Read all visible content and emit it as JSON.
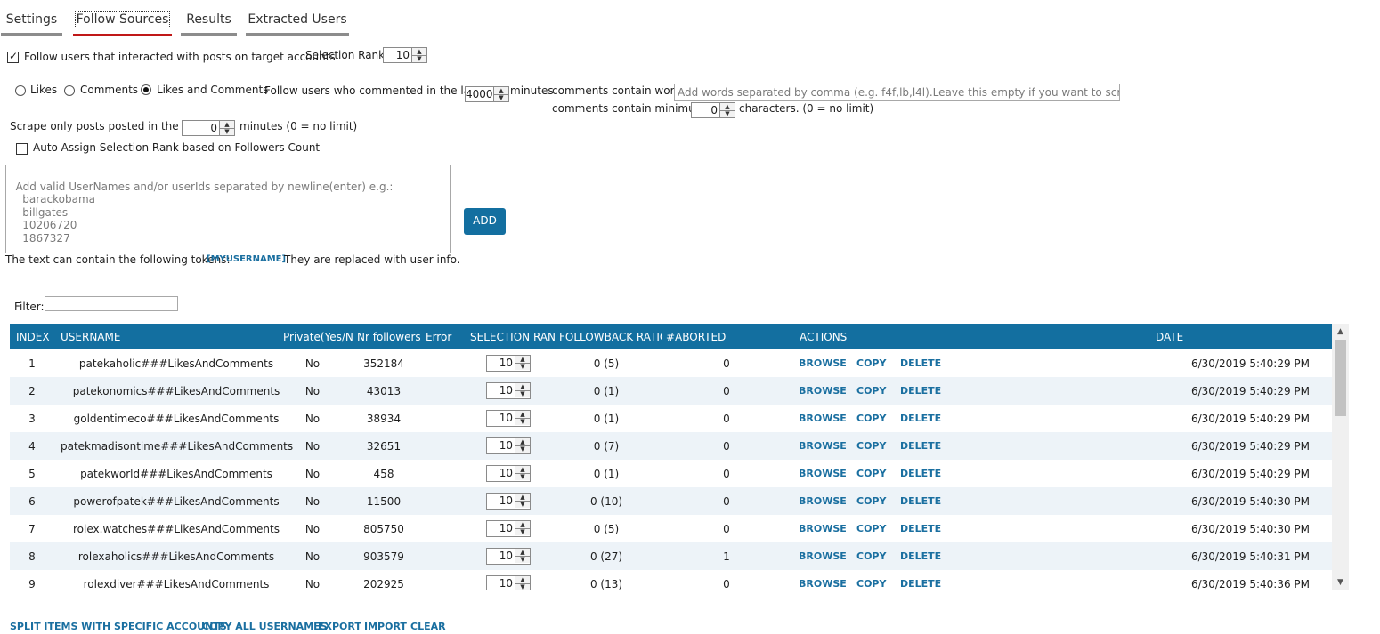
{
  "tabs": [
    {
      "label": "Settings"
    },
    {
      "label": "Follow Sources"
    },
    {
      "label": "Results"
    },
    {
      "label": "Extracted Users"
    }
  ],
  "interact": {
    "checked": true,
    "label": "Follow users that interacted with posts on target accounts",
    "rank_label": "Selection Rank",
    "rank_value": "10"
  },
  "mode": {
    "likes": "Likes",
    "comments": "Comments",
    "likes_and_comments": "Likes and Comments",
    "selected": "likes_and_comments",
    "commented_label": "Follow users who commented in the last",
    "commented_value": "4000",
    "minutes_label": "minutes",
    "words_label": "comments contain words",
    "words_placeholder": "Add words separated by comma (e.g. f4f,lb,l4l).Leave this empty if you want to scrape all comments",
    "min_label": "comments contain minimum",
    "min_value": "0",
    "chars_label": "characters. (0 = no limit)"
  },
  "scrape": {
    "label": "Scrape only posts posted in the last",
    "value": "0",
    "suffix": "minutes (0 = no limit)"
  },
  "auto_assign": {
    "checked": false,
    "label": "Auto Assign Selection Rank based on Followers Count"
  },
  "usernames": {
    "placeholder": "Add valid UserNames and/or userIds separated by newline(enter) e.g.:\n    barackobama\n    billgates\n    10206720\n    1867327",
    "add_label": "ADD"
  },
  "tokens": {
    "prefix": "The text can contain the following tokens:",
    "token": "[MYUSERNAME]",
    "suffix": "They are replaced with user info."
  },
  "filter": {
    "label": "Filter:",
    "value": ""
  },
  "grid": {
    "columns": [
      "INDEX",
      "USERNAME",
      "Private(Yes/No)",
      "Nr followers",
      "Error",
      "SELECTION RANK",
      "FOLLOWBACK RATIO",
      "#ABORTED",
      "ACTIONS",
      "DATE"
    ],
    "actions": [
      "BROWSE",
      "COPY",
      "DELETE"
    ],
    "rows": [
      {
        "index": "1",
        "username": "patekaholic###LikesAndComments",
        "private": "No",
        "followers": "352184",
        "error": "",
        "rank": "10",
        "ratio": "0 (5)",
        "aborted": "0",
        "date": "6/30/2019 5:40:29 PM"
      },
      {
        "index": "2",
        "username": "patekonomics###LikesAndComments",
        "private": "No",
        "followers": "43013",
        "error": "",
        "rank": "10",
        "ratio": "0 (1)",
        "aborted": "0",
        "date": "6/30/2019 5:40:29 PM"
      },
      {
        "index": "3",
        "username": "goldentimeco###LikesAndComments",
        "private": "No",
        "followers": "38934",
        "error": "",
        "rank": "10",
        "ratio": "0 (1)",
        "aborted": "0",
        "date": "6/30/2019 5:40:29 PM"
      },
      {
        "index": "4",
        "username": "patekmadisontime###LikesAndComments",
        "private": "No",
        "followers": "32651",
        "error": "",
        "rank": "10",
        "ratio": "0 (7)",
        "aborted": "0",
        "date": "6/30/2019 5:40:29 PM"
      },
      {
        "index": "5",
        "username": "patekworld###LikesAndComments",
        "private": "No",
        "followers": "458",
        "error": "",
        "rank": "10",
        "ratio": "0 (1)",
        "aborted": "0",
        "date": "6/30/2019 5:40:29 PM"
      },
      {
        "index": "6",
        "username": "powerofpatek###LikesAndComments",
        "private": "No",
        "followers": "11500",
        "error": "",
        "rank": "10",
        "ratio": "0 (10)",
        "aborted": "0",
        "date": "6/30/2019 5:40:30 PM"
      },
      {
        "index": "7",
        "username": "rolex.watches###LikesAndComments",
        "private": "No",
        "followers": "805750",
        "error": "",
        "rank": "10",
        "ratio": "0 (5)",
        "aborted": "0",
        "date": "6/30/2019 5:40:30 PM"
      },
      {
        "index": "8",
        "username": "rolexaholics###LikesAndComments",
        "private": "No",
        "followers": "903579",
        "error": "",
        "rank": "10",
        "ratio": "0 (27)",
        "aborted": "1",
        "date": "6/30/2019 5:40:31 PM"
      },
      {
        "index": "9",
        "username": "rolexdiver###LikesAndComments",
        "private": "No",
        "followers": "202925",
        "error": "",
        "rank": "10",
        "ratio": "0 (13)",
        "aborted": "0",
        "date": "6/30/2019 5:40:36 PM"
      }
    ]
  },
  "footer": [
    "SPLIT ITEMS WITH SPECIFIC ACCOUNTS",
    "COPY ALL USERNAMES",
    "EXPORT",
    "IMPORT",
    "CLEAR"
  ],
  "icons": {
    "spin_up": "▲",
    "spin_down": "▼",
    "check": "✓",
    "scroll_up": "▲",
    "scroll_down": "▼"
  },
  "colors": {
    "accent": "#136fa0",
    "link": "#1a6fa0",
    "active_tab": "#c01818",
    "row_alt": "#edf3f8"
  }
}
